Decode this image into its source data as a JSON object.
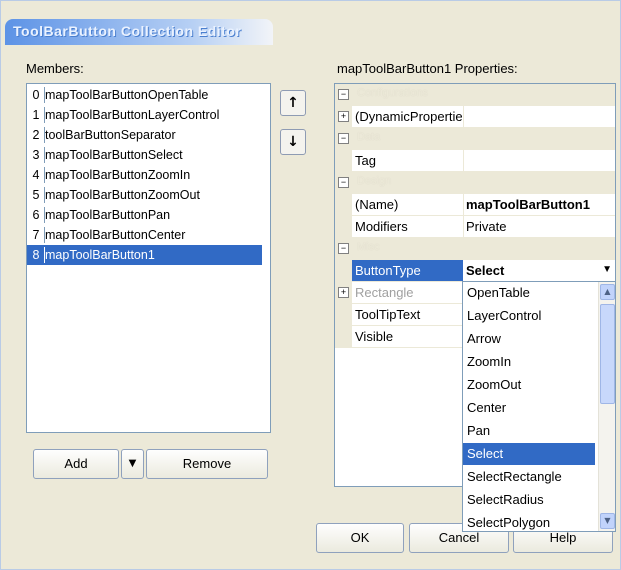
{
  "window": {
    "title": "ToolBarButton Collection Editor"
  },
  "members": {
    "label": "Members:",
    "items": [
      {
        "index": "0",
        "name": "mapToolBarButtonOpenTable"
      },
      {
        "index": "1",
        "name": "mapToolBarButtonLayerControl"
      },
      {
        "index": "2",
        "name": "toolBarButtonSeparator"
      },
      {
        "index": "3",
        "name": "mapToolBarButtonSelect"
      },
      {
        "index": "4",
        "name": "mapToolBarButtonZoomIn"
      },
      {
        "index": "5",
        "name": "mapToolBarButtonZoomOut"
      },
      {
        "index": "6",
        "name": "mapToolBarButtonPan"
      },
      {
        "index": "7",
        "name": "mapToolBarButtonCenter"
      },
      {
        "index": "8",
        "name": "mapToolBarButton1"
      }
    ],
    "selected_index": 8,
    "move_up_icon": "↑",
    "move_down_icon": "↓",
    "add_label": "Add",
    "add_dropdown_icon": "▼",
    "remove_label": "Remove"
  },
  "properties": {
    "label": "mapToolBarButton1 Properties:",
    "categories": {
      "configurations": "Configurations",
      "data": "Data",
      "design": "Design",
      "misc": "Misc"
    },
    "rows": {
      "dynamic": "(DynamicPropertie",
      "tag_name": "Tag",
      "name_name": "(Name)",
      "name_value": "mapToolBarButton1",
      "modifiers_name": "Modifiers",
      "modifiers_value": "Private",
      "buttontype_name": "ButtonType",
      "buttontype_value": "Select",
      "rectangle_name": "Rectangle",
      "tooltip_name": "ToolTipText",
      "visible_name": "Visible"
    },
    "expand_icon": "+",
    "collapse_icon": "−",
    "combo_arrow_icon": "▼"
  },
  "dropdown": {
    "options": [
      "OpenTable",
      "LayerControl",
      "Arrow",
      "ZoomIn",
      "ZoomOut",
      "Center",
      "Pan",
      "Select",
      "SelectRectangle",
      "SelectRadius",
      "SelectPolygon"
    ],
    "selected": "Select",
    "scroll_up_icon": "▲",
    "scroll_down_icon": "▼"
  },
  "footer": {
    "ok_label": "OK",
    "cancel_partial": "Cancel",
    "help_partial": "Help"
  }
}
